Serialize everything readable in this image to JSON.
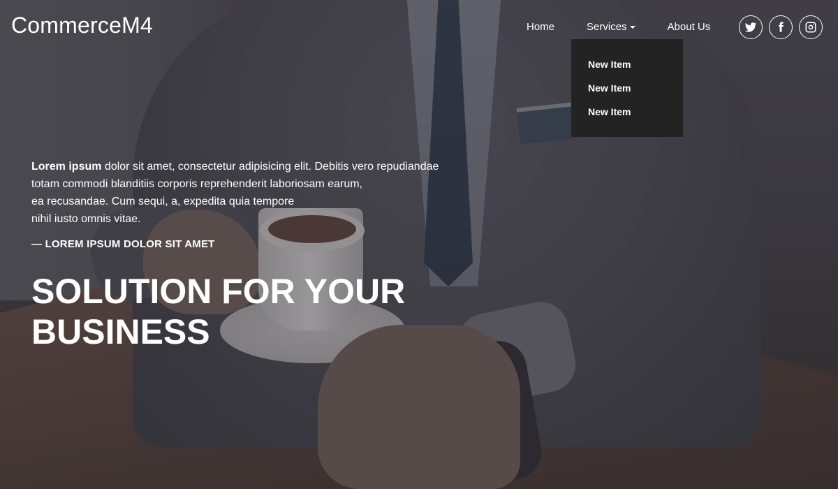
{
  "brand": "CommerceM4",
  "nav": {
    "home": "Home",
    "services": "Services",
    "about": "About Us"
  },
  "dropdown": {
    "items": [
      "New Item",
      "New Item",
      "New Item"
    ]
  },
  "social": {
    "twitter_icon": "twitter-icon",
    "facebook_icon": "facebook-icon",
    "instagram_icon": "instagram-icon"
  },
  "hero": {
    "lead_bold": "Lorem ipsum",
    "lead_line1": " dolor sit amet, consectetur adipisicing elit. Debitis vero repudiandae",
    "lead_line2": "totam commodi blanditiis corporis reprehenderit laboriosam earum,",
    "lead_line3": "ea recusandae. Cum sequi, a, expedita quia tempore",
    "lead_line4": "nihil iusto omnis vitae.",
    "attribution": "— LOREM IPSUM DOLOR SIT AMET",
    "headline_line1": "SOLUTION FOR YOUR",
    "headline_line2": "BUSINESS"
  }
}
